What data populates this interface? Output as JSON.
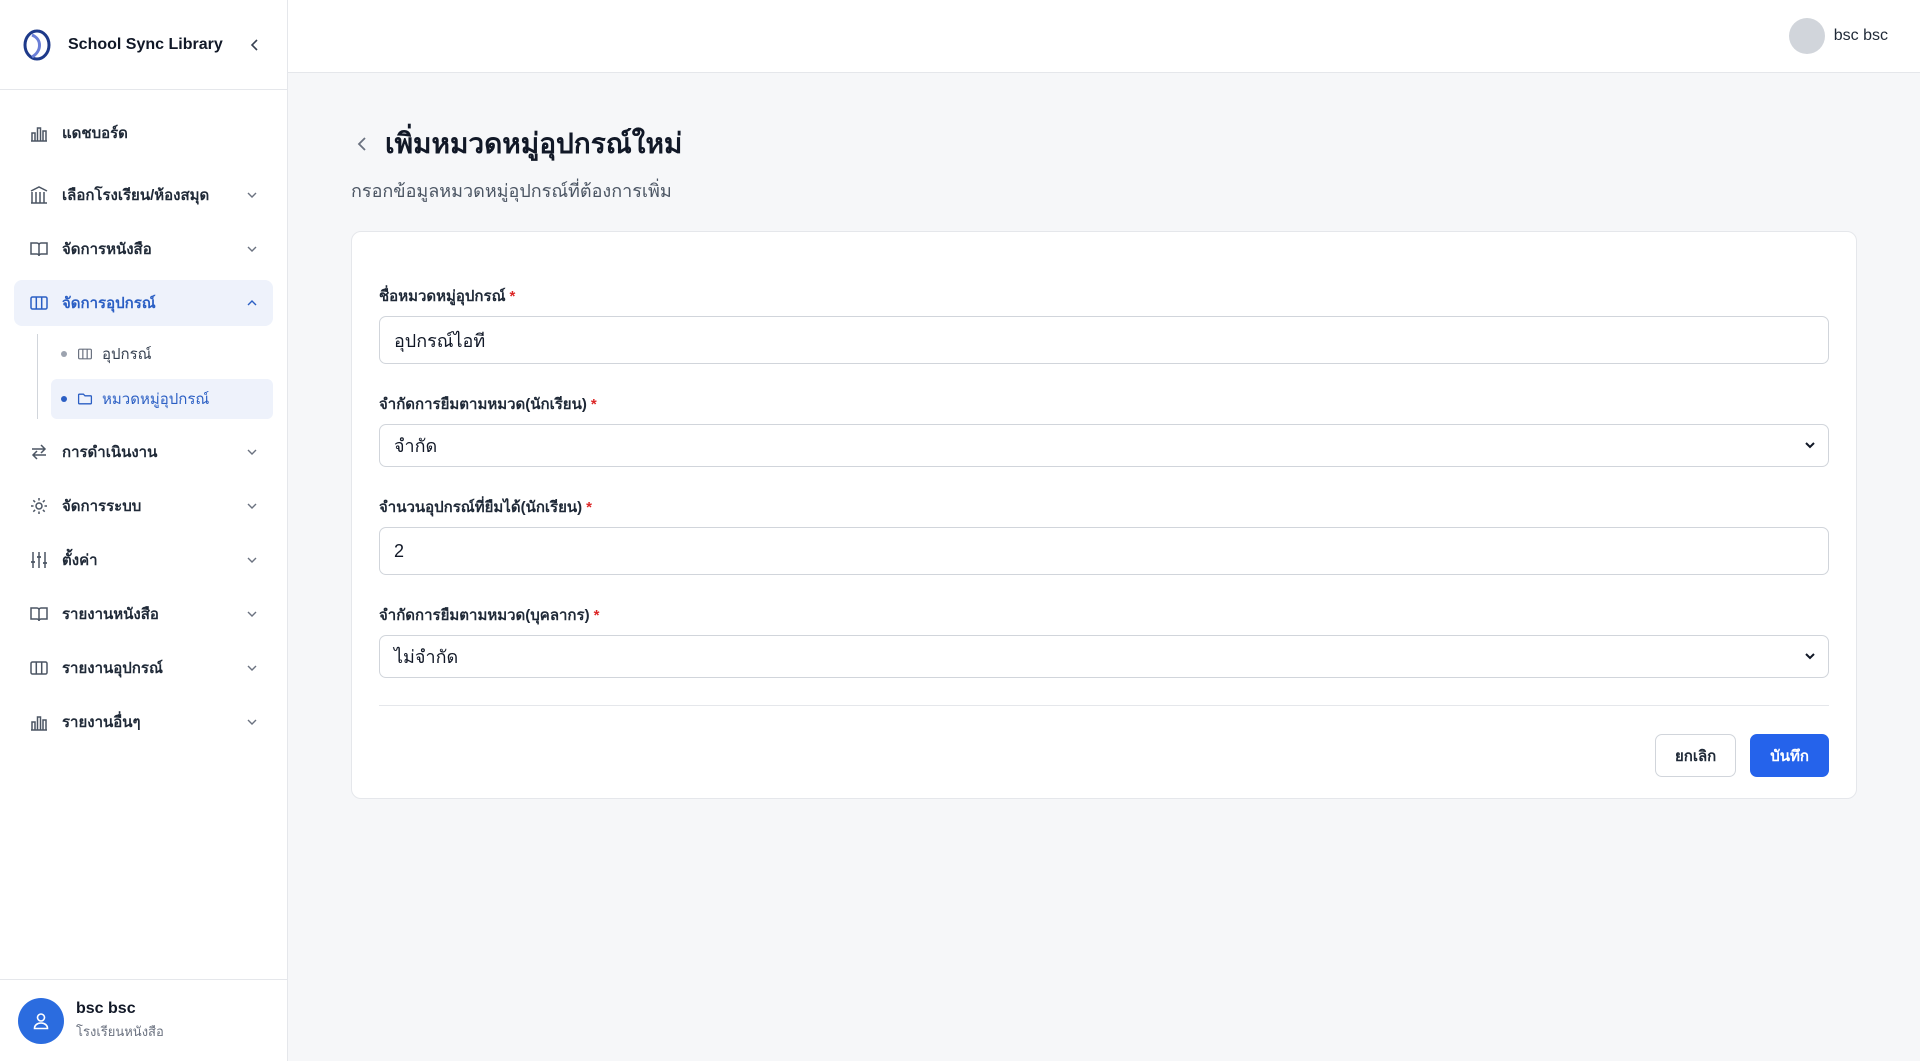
{
  "app": {
    "name": "School Sync Library"
  },
  "header": {
    "user_name": "bsc bsc"
  },
  "sidebar": {
    "items": [
      {
        "label": "แดชบอร์ด",
        "icon": "bar-chart-icon"
      },
      {
        "label": "เลือกโรงเรียน/ห้องสมุด",
        "icon": "library-icon"
      },
      {
        "label": "จัดการหนังสือ",
        "icon": "book-icon"
      },
      {
        "label": "จัดการอุปกรณ์",
        "icon": "columns-icon",
        "active": true,
        "children": [
          {
            "label": "อุปกรณ์",
            "icon": "columns-icon"
          },
          {
            "label": "หมวดหมู่อุปกรณ์",
            "icon": "folder-icon",
            "active": true
          }
        ]
      },
      {
        "label": "การดำเนินงาน",
        "icon": "arrows-swap-icon"
      },
      {
        "label": "จัดการระบบ",
        "icon": "gear-icon"
      },
      {
        "label": "ตั้งค่า",
        "icon": "sliders-icon"
      },
      {
        "label": "รายงานหนังสือ",
        "icon": "book-icon"
      },
      {
        "label": "รายงานอุปกรณ์",
        "icon": "columns-icon"
      },
      {
        "label": "รายงานอื่นๆ",
        "icon": "bar-chart-icon"
      }
    ],
    "user": {
      "name": "bsc bsc",
      "role": "โรงเรียนหนังสือ"
    }
  },
  "main": {
    "title": "เพิ่มหมวดหมู่อุปกรณ์ใหม่",
    "subtitle": "กรอกข้อมูลหมวดหมู่อุปกรณ์ที่ต้องการเพิ่ม",
    "form": {
      "name": {
        "label": "ชื่อหมวดหมู่อุปกรณ์",
        "value": "อุปกรณ์ไอที"
      },
      "student_limit": {
        "label": "จำกัดการยืมตามหมวด(นักเรียน)",
        "value": "จำกัด"
      },
      "student_count": {
        "label": "จำนวนอุปกรณ์ที่ยืมได้(นักเรียน)",
        "value": "2"
      },
      "staff_limit": {
        "label": "จำกัดการยืมตามหมวด(บุคลากร)",
        "value": "ไม่จำกัด"
      },
      "required_mark": "*",
      "cancel_label": "ยกเลิก",
      "save_label": "บันทึก"
    }
  },
  "colors": {
    "accent": "#2563eb",
    "active_bg": "#eef2fb",
    "required": "#dc2626"
  }
}
